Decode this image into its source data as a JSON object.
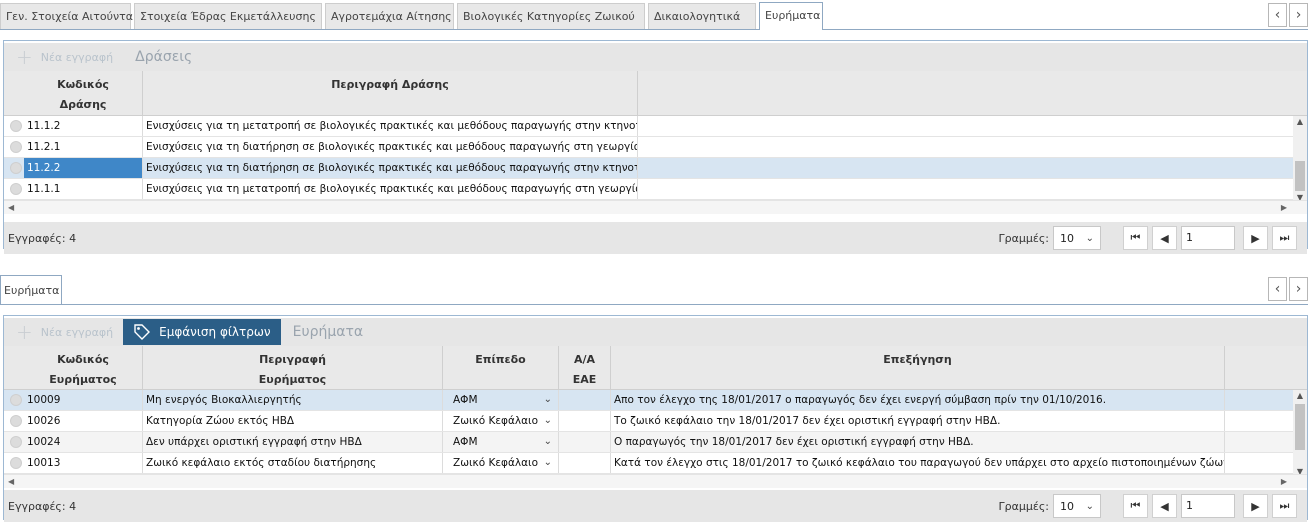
{
  "tabs": [
    {
      "label": "Γεν. Στοιχεία Αιτούντα"
    },
    {
      "label": "Στοιχεία Έδρας Εκμετάλλευσης"
    },
    {
      "label": "Αγροτεμάχια Αίτησης"
    },
    {
      "label": "Βιολογικές Κατηγορίες Ζωικού"
    },
    {
      "label": "Δικαιολογητικά"
    },
    {
      "label": "Ευρήματα"
    }
  ],
  "nav": {
    "prev": "‹",
    "next": "›"
  },
  "actions": {
    "new_label": "Νέα εγγραφή",
    "title": "Δράσεις",
    "columns": [
      {
        "line1": "Κωδικός",
        "line2": "Δράσης"
      },
      {
        "line1": "Περιγραφή Δράσης",
        "line2": ""
      }
    ],
    "rows": [
      {
        "code": "11.1.2",
        "desc": "Ενισχύσεις για τη μετατροπή σε βιολογικές πρακτικές και μεθόδους παραγωγής στην κτηνοτροφία"
      },
      {
        "code": "11.2.1",
        "desc": "Ενισχύσεις για τη διατήρηση σε βιολογικές πρακτικές και μεθόδους παραγωγής στη γεωργία"
      },
      {
        "code": "11.2.2",
        "desc": "Ενισχύσεις για τη διατήρηση σε βιολογικές πρακτικές και μεθόδους παραγωγής στην κτηνοτροφία"
      },
      {
        "code": "11.1.1",
        "desc": "Ενισχύσεις για τη μετατροπή σε βιολογικές πρακτικές και μεθόδους παραγωγής στη γεωργία"
      }
    ],
    "selected_row": 2,
    "footer": {
      "count": "Εγγραφές: 4",
      "lines_label": "Γραμμές:",
      "lines_value": "10",
      "page": "1"
    }
  },
  "findings_tab": {
    "label": "Ευρήματα"
  },
  "findings": {
    "new_label": "Νέα εγγραφή",
    "filter_label": "Εμφάνιση φίλτρων",
    "title": "Ευρήματα",
    "columns": [
      {
        "line1": "Κωδικός",
        "line2": "Ευρήματος"
      },
      {
        "line1": "Περιγραφή",
        "line2": "Ευρήματος"
      },
      {
        "line1": "Επίπεδο",
        "line2": ""
      },
      {
        "line1": "Α/Α",
        "line2": "ΕΑΕ"
      },
      {
        "line1": "Επεξήγηση",
        "line2": ""
      }
    ],
    "rows": [
      {
        "code": "10009",
        "desc": "Μη ενεργός Βιοκαλλιεργητής",
        "level": "ΑΦΜ",
        "aa": "",
        "expl": "Απο τον έλεγχο της 18/01/2017 ο παραγωγός δεν έχει ενεργή σύμβαση πρίν την 01/10/2016."
      },
      {
        "code": "10026",
        "desc": "Κατηγορία Ζώου εκτός ΗΒΔ",
        "level": "Ζωικό Κεφάλαιο",
        "aa": "",
        "expl": "Το ζωικό κεφάλαιο την 18/01/2017 δεν έχει οριστική εγγραφή στην ΗΒΔ."
      },
      {
        "code": "10024",
        "desc": "Δεν υπάρχει οριστική εγγραφή στην ΗΒΔ",
        "level": "ΑΦΜ",
        "aa": "",
        "expl": "Ο παραγωγός την 18/01/2017 δεν έχει οριστική εγγραφή στην ΗΒΔ."
      },
      {
        "code": "10013",
        "desc": "Ζωικό κεφάλαιο εκτός σταδίου διατήρησης",
        "level": "Ζωικό Κεφάλαιο",
        "aa": "",
        "expl": "Κατά τον έλεγχο στις 18/01/2017 το ζωικό κεφάλαιο του παραγωγού δεν υπάρχει στο αρχείο πιστοποιημένων ζώων με ημερομ"
      }
    ],
    "footer": {
      "count": "Εγγραφές: 4",
      "lines_label": "Γραμμές:",
      "lines_value": "10",
      "page": "1"
    }
  },
  "colors": {
    "accent": "#2b5e87",
    "selection": "#3f87c8",
    "selected_row": "#d7e5f2",
    "border": "#9db8d3"
  }
}
